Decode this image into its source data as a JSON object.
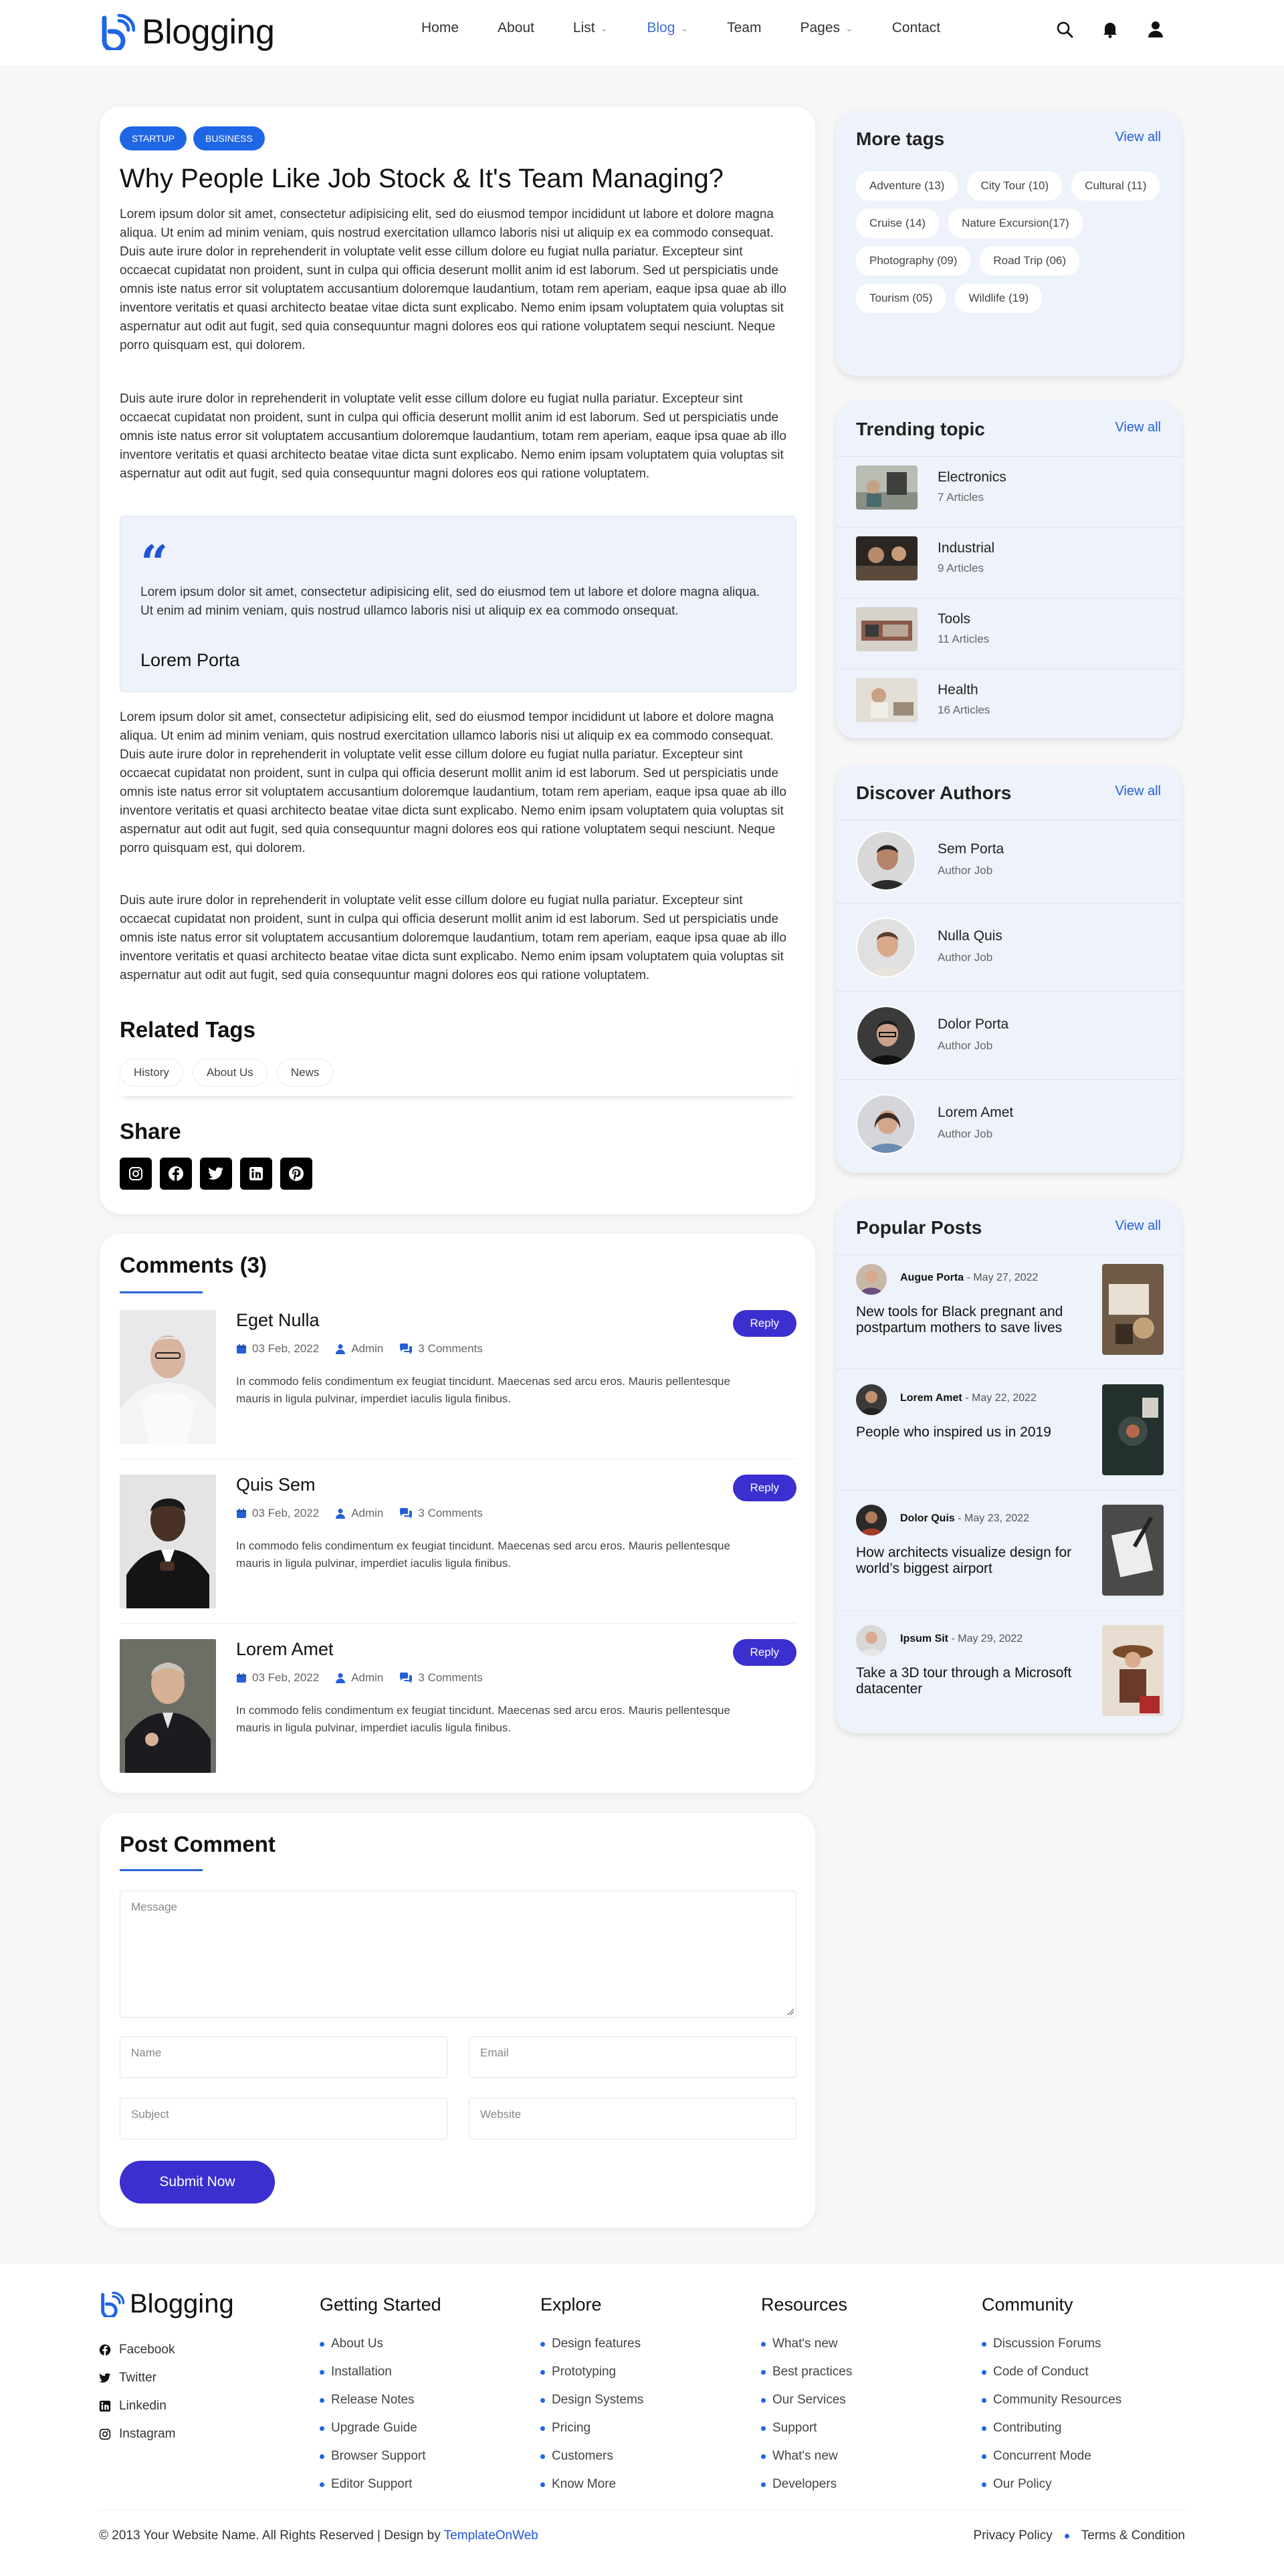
{
  "header": {
    "logo_text": "Blogging",
    "nav": [
      {
        "label": "Home",
        "dropdown": false,
        "active": false
      },
      {
        "label": "About",
        "dropdown": false,
        "active": false
      },
      {
        "label": "List",
        "dropdown": true,
        "active": false
      },
      {
        "label": "Blog",
        "dropdown": true,
        "active": true
      },
      {
        "label": "Team",
        "dropdown": false,
        "active": false
      },
      {
        "label": "Pages",
        "dropdown": true,
        "active": false
      },
      {
        "label": "Contact",
        "dropdown": false,
        "active": false
      }
    ],
    "icons": [
      "search-icon",
      "bell-icon",
      "user-icon"
    ]
  },
  "article": {
    "badges": [
      "STARTUP",
      "BUSINESS"
    ],
    "title": "Why People Like Job Stock & It's Team Managing?",
    "p1": "Lorem ipsum dolor sit amet, consectetur adipisicing elit, sed do eiusmod tempor incididunt ut labore et dolore magna aliqua. Ut enim ad minim veniam, quis nostrud exercitation ullamco laboris nisi ut aliquip ex ea commodo consequat. Duis aute irure dolor in reprehenderit in voluptate velit esse cillum dolore eu fugiat nulla pariatur. Excepteur sint occaecat cupidatat non proident, sunt in culpa qui officia deserunt mollit anim id est laborum. Sed ut perspiciatis unde omnis iste natus error sit voluptatem accusantium doloremque laudantium, totam rem aperiam, eaque ipsa quae ab illo inventore veritatis et quasi architecto beatae vitae dicta sunt explicabo. Nemo enim ipsam voluptatem quia voluptas sit aspernatur aut odit aut fugit, sed quia consequuntur magni dolores eos qui ratione voluptatem sequi nesciunt. Neque porro quisquam est, qui dolorem.",
    "p2": "Duis aute irure dolor in reprehenderit in voluptate velit esse cillum dolore eu fugiat nulla pariatur. Excepteur sint occaecat cupidatat non proident, sunt in culpa qui officia deserunt mollit anim id est laborum. Sed ut perspiciatis unde omnis iste natus error sit voluptatem accusantium doloremque laudantium, totam rem aperiam, eaque ipsa quae ab illo inventore veritatis et quasi architecto beatae vitae dicta sunt explicabo. Nemo enim ipsam voluptatem quia voluptas sit aspernatur aut odit aut fugit, sed quia consequuntur magni dolores eos qui ratione voluptatem.",
    "quote_text": "Lorem ipsum dolor sit amet, consectetur adipisicing elit, sed do eiusmod tem ut labore et dolore magna aliqua. Ut enim ad minim veniam, quis nostrud ullamco laboris nisi ut aliquip ex ea commodo onsequat.",
    "quote_author": "Lorem Porta",
    "p3": "Lorem ipsum dolor sit amet, consectetur adipisicing elit, sed do eiusmod tempor incididunt ut labore et dolore magna aliqua. Ut enim ad minim veniam, quis nostrud exercitation ullamco laboris nisi ut aliquip ex ea commodo consequat. Duis aute irure dolor in reprehenderit in voluptate velit esse cillum dolore eu fugiat nulla pariatur. Excepteur sint occaecat cupidatat non proident, sunt in culpa qui officia deserunt mollit anim id est laborum. Sed ut perspiciatis unde omnis iste natus error sit voluptatem accusantium doloremque laudantium, totam rem aperiam, eaque ipsa quae ab illo inventore veritatis et quasi architecto beatae vitae dicta sunt explicabo. Nemo enim ipsam voluptatem quia voluptas sit aspernatur aut odit aut fugit, sed quia consequuntur magni dolores eos qui ratione voluptatem sequi nesciunt. Neque porro quisquam est, qui dolorem.",
    "p4": "Duis aute irure dolor in reprehenderit in voluptate velit esse cillum dolore eu fugiat nulla pariatur. Excepteur sint occaecat cupidatat non proident, sunt in culpa qui officia deserunt mollit anim id est laborum. Sed ut perspiciatis unde omnis iste natus error sit voluptatem accusantium doloremque laudantium, totam rem aperiam, eaque ipsa quae ab illo inventore veritatis et quasi architecto beatae vitae dicta sunt explicabo. Nemo enim ipsam voluptatem quia voluptas sit aspernatur aut odit aut fugit, sed quia consequuntur magni dolores eos qui ratione voluptatem.",
    "related_title": "Related Tags",
    "related_tags": [
      "History",
      "About Us",
      "News"
    ],
    "share_title": "Share",
    "share_icons": [
      "instagram-icon",
      "facebook-icon",
      "twitter-icon",
      "linkedin-icon",
      "pinterest-icon"
    ]
  },
  "comments": {
    "title": "Comments (3)",
    "items": [
      {
        "name": "Eget Nulla",
        "date": "03 Feb, 2022",
        "author": "Admin",
        "count": "3 Comments",
        "text": "In commodo felis condimentum ex feugiat tincidunt. Maecenas sed arcu eros. Mauris pellentesque mauris in ligula pulvinar, imperdiet iaculis ligula finibus.",
        "reply": "Reply"
      },
      {
        "name": "Quis Sem",
        "date": "03 Feb, 2022",
        "author": "Admin",
        "count": "3 Comments",
        "text": "In commodo felis condimentum ex feugiat tincidunt. Maecenas sed arcu eros. Mauris pellentesque mauris in ligula pulvinar, imperdiet iaculis ligula finibus.",
        "reply": "Reply"
      },
      {
        "name": "Lorem Amet",
        "date": "03 Feb, 2022",
        "author": "Admin",
        "count": "3 Comments",
        "text": "In commodo felis condimentum ex feugiat tincidunt. Maecenas sed arcu eros. Mauris pellentesque mauris in ligula pulvinar, imperdiet iaculis ligula finibus.",
        "reply": "Reply"
      }
    ]
  },
  "post_comment": {
    "title": "Post Comment",
    "message_placeholder": "Message",
    "name_placeholder": "Name",
    "email_placeholder": "Email",
    "subject_placeholder": "Subject",
    "website_placeholder": "Website",
    "submit": "Submit Now"
  },
  "sidebar": {
    "more_tags": {
      "title": "More tags",
      "view_all": "View all",
      "tags": [
        "Adventure (13)",
        "City Tour (10)",
        "Cultural (11)",
        "Cruise (14)",
        "Nature Excursion(17)",
        "Photography (09)",
        "Road Trip (06)",
        "Tourism (05)",
        "Wildlife (19)"
      ]
    },
    "trending": {
      "title": "Trending topic",
      "view_all": "View all",
      "items": [
        {
          "name": "Electronics",
          "count": "7 Articles"
        },
        {
          "name": "Industrial",
          "count": "9 Articles"
        },
        {
          "name": "Tools",
          "count": "11 Articles"
        },
        {
          "name": "Health",
          "count": "16 Articles"
        }
      ]
    },
    "authors": {
      "title": "Discover Authors",
      "view_all": "View all",
      "items": [
        {
          "name": "Sem Porta",
          "job": "Author Job"
        },
        {
          "name": "Nulla Quis",
          "job": "Author Job"
        },
        {
          "name": "Dolor Porta",
          "job": "Author Job"
        },
        {
          "name": "Lorem Amet",
          "job": "Author Job"
        }
      ]
    },
    "popular": {
      "title": "Popular Posts",
      "view_all": "View all",
      "items": [
        {
          "author": "Augue Porta",
          "date": "- May 27, 2022",
          "title": "New tools for Black pregnant and postpartum mothers to save lives"
        },
        {
          "author": "Lorem Amet",
          "date": "- May 22, 2022",
          "title": "People who inspired us in 2019"
        },
        {
          "author": "Dolor Quis",
          "date": "- May 23, 2022",
          "title": "How architects visualize design for world’s biggest airport"
        },
        {
          "author": "Ipsum Sit",
          "date": "- May 29, 2022",
          "title": "Take a 3D tour through a Microsoft datacenter"
        }
      ]
    }
  },
  "footer": {
    "logo_text": "Blogging",
    "social": [
      "Facebook",
      "Twitter",
      "Linkedin",
      "Instagram"
    ],
    "columns": [
      {
        "title": "Getting Started",
        "links": [
          "About Us",
          "Installation",
          "Release Notes",
          "Upgrade Guide",
          "Browser Support",
          "Editor Support"
        ]
      },
      {
        "title": "Explore",
        "links": [
          "Design features",
          "Prototyping",
          "Design Systems",
          "Pricing",
          "Customers",
          "Know More"
        ]
      },
      {
        "title": "Resources",
        "links": [
          "What's new",
          "Best practices",
          "Our Services",
          "Support",
          "What's new",
          "Developers"
        ]
      },
      {
        "title": "Community",
        "links": [
          "Discussion Forums",
          "Code of Conduct",
          "Community Resources",
          "Contributing",
          "Concurrent Mode",
          "Our Policy"
        ]
      }
    ],
    "copyright": "© 2013 Your Website Name. All Rights Reserved | Design by",
    "brand": "TemplateOnWeb",
    "legal": [
      "Privacy Policy",
      "Terms & Condition"
    ]
  },
  "colors": {
    "accent": "#1f66e5",
    "button": "#3b2fd0",
    "sidebar_bg": "#eef2fa"
  }
}
